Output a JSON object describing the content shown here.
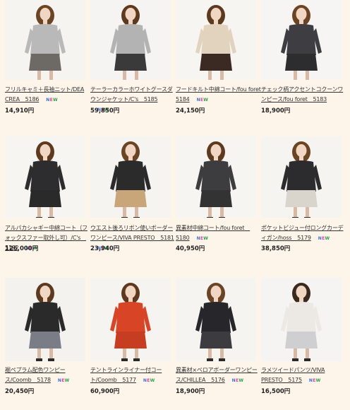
{
  "products": [
    {
      "title": "フリルキャミ＋長袖ニット/DEA CREA　5186",
      "price": "14,910円",
      "badge": "NEW",
      "colors": {
        "top": "#b9b9b9",
        "bottom": "#6d6a66",
        "hair": "#6b4424",
        "bg": "#f6f4f1"
      }
    },
    {
      "title": "テーラーカラーホワイトグースダウンジャケット/C's　5185",
      "price": "59,850円",
      "badge": "NEW",
      "colors": {
        "top": "#b3b3b3",
        "bottom": "#3a3a3a",
        "hair": "#5d3a1f",
        "bg": "#f5f4f2"
      }
    },
    {
      "title": "フードキルト中綿コート/fou foret　5184",
      "price": "24,150円",
      "badge": "NEW",
      "colors": {
        "top": "#e2d3bf",
        "bottom": "#3b2a23",
        "hair": "#5d3a1f",
        "bg": "#f7f5f2"
      }
    },
    {
      "title": "チェック柄アクセントコクーンワンピース/fou foret　5183",
      "price": "18,900円",
      "badge": "",
      "colors": {
        "top": "#3e3e42",
        "bottom": "#2d2d30",
        "hair": "#6b4424",
        "bg": "#f6f5f3"
      }
    },
    {
      "title": "アルパカシャギー中綿コート（フォックスファー取外し可）/C's　5182",
      "price": "126,000円",
      "badge": "NEW",
      "colors": {
        "top": "#2d2d2f",
        "bottom": "#2a2a2a",
        "hair": "#5d3a1f",
        "bg": "#f7f5f2"
      }
    },
    {
      "title": "ウエスト後ろリボン使いボーダーワンピース/VIVA PRESTO　5181",
      "price": "23,940円",
      "badge": "NEW",
      "colors": {
        "top": "#2b2b2b",
        "bottom": "#c9a57a",
        "hair": "#6b4424",
        "bg": "#f6f4f1"
      }
    },
    {
      "title": "異素材中綿コート/fou foret　5180",
      "price": "40,950円",
      "badge": "NEW",
      "colors": {
        "top": "#3d3d3f",
        "bottom": "#333333",
        "hair": "#5d3a1f",
        "bg": "#f7f5f2"
      }
    },
    {
      "title": "ポケットビジュー付ロングカーディガン/hoss　5179",
      "price": "38,850円",
      "badge": "NEW",
      "colors": {
        "top": "#2c2c2e",
        "bottom": "#d9d4cc",
        "hair": "#6b4424",
        "bg": "#f6f4f1"
      }
    },
    {
      "title": "裾ペプラム配色ワンピース/Coomb　5178",
      "price": "20,450円",
      "badge": "NEW",
      "colors": {
        "top": "#2a2a2a",
        "bottom": "#7b7d86",
        "hair": "#5d3a1f",
        "bg": "#f3f2ef"
      }
    },
    {
      "title": "テントラインライナー付コート/Coomb　5177",
      "price": "60,900円",
      "badge": "NEW",
      "colors": {
        "top": "#d84426",
        "bottom": "#c63d22",
        "hair": "#5d3a1f",
        "bg": "#f6f4f1"
      }
    },
    {
      "title": "異素材×ベロアボーダーワンピース/CHILLEA　5176",
      "price": "18,900円",
      "badge": "NEW",
      "colors": {
        "top": "#27272b",
        "bottom": "#3b3b40",
        "hair": "#6b4424",
        "bg": "#f6f4f1"
      }
    },
    {
      "title": "ラメツイードパンツ/VIVA PRESTO　5175",
      "price": "16,500円",
      "badge": "NEW",
      "colors": {
        "top": "#ece9e4",
        "bottom": "#cfcfd2",
        "hair": "#3a2a1e",
        "bg": "#f5f4f2"
      }
    }
  ]
}
